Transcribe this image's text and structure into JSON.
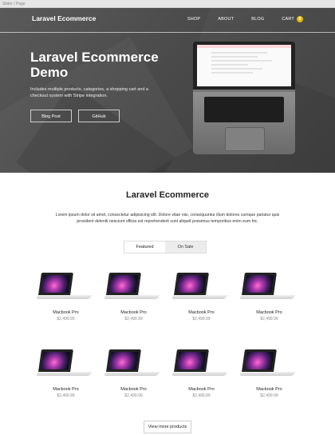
{
  "browser": {
    "strip_text": "Slider / Page"
  },
  "nav": {
    "brand": "Laravel Ecommerce",
    "links": [
      "SHOP",
      "ABOUT",
      "BLOG"
    ],
    "cart_label": "CART",
    "cart_count": "0"
  },
  "hero": {
    "title": "Laravel Ecommerce Demo",
    "description": "Includes multiple products, categories, a shopping cart and a checkout system with Stripe integration.",
    "buttons": [
      "Blog Post",
      "GitHub"
    ]
  },
  "main": {
    "title": "Laravel Ecommerce",
    "lorem": "Lorem ipsum dolor sit amet, consectetur adipisicing elit. Dolore vitae nisi, consequuntur illum dolores cumque pariatur quis provident deleniti nesciunt officia est reprehenderit sunt aliquid possimus temporibus enim eum hic.",
    "tabs": [
      {
        "label": "Featured",
        "active": true
      },
      {
        "label": "On Sale",
        "active": false
      }
    ],
    "products": [
      {
        "name": "Macbook Pro",
        "price": "$2,499.99"
      },
      {
        "name": "Macbook Pro",
        "price": "$2,499.99"
      },
      {
        "name": "Macbook Pro",
        "price": "$2,499.99"
      },
      {
        "name": "Macbook Pro",
        "price": "$2,499.99"
      },
      {
        "name": "Macbook Pro",
        "price": "$2,499.99"
      },
      {
        "name": "Macbook Pro",
        "price": "$2,499.99"
      },
      {
        "name": "Macbook Pro",
        "price": "$2,499.99"
      },
      {
        "name": "Macbook Pro",
        "price": "$2,499.99"
      }
    ],
    "view_more": "View more products"
  },
  "colors": {
    "hero_bg": "#4e4e4e",
    "cart_badge": "#e5b800",
    "tab_inactive_bg": "#ececec"
  }
}
